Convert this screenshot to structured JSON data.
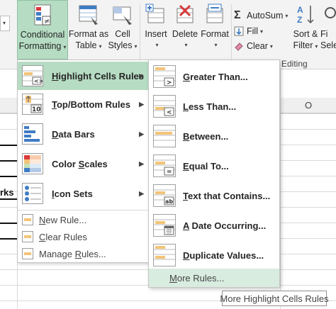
{
  "ribbon": {
    "conditional_formatting_line1": "Conditional",
    "conditional_formatting_line2": "Formatting",
    "format_as_table_line1": "Format as",
    "format_as_table_line2": "Table",
    "cell_styles_line1": "Cell",
    "cell_styles_line2": "Styles",
    "insert": "Insert",
    "delete": "Delete",
    "format": "Format",
    "autosum": "AutoSum",
    "fill": "Fill",
    "clear": "Clear",
    "sort_filter_line1": "Sort &",
    "sort_filter_line2": "Filter",
    "find_select_line1": "Fi",
    "find_select_line2": "Sele",
    "editing_label": "Editing"
  },
  "sheet": {
    "column_header_o": "O",
    "left_cell_text": "rks"
  },
  "conditional_menu": {
    "items": [
      {
        "label": "Highlight Cells Rules",
        "underline": "H",
        "rest": "ighlight Cells Rules"
      },
      {
        "label": "Top/Bottom Rules",
        "underline": "T",
        "rest": "op/Bottom Rules"
      },
      {
        "label": "Data Bars",
        "underline": "D",
        "rest": "ata Bars"
      },
      {
        "label": "Color Scales",
        "underline": "S",
        "pre": "Color ",
        "rest": "cales"
      },
      {
        "label": "Icon Sets",
        "underline": "I",
        "rest": "con Sets"
      }
    ],
    "small_items": [
      {
        "pre": "",
        "underline": "N",
        "rest": "ew Rule..."
      },
      {
        "pre": "",
        "underline": "C",
        "rest": "lear Rules"
      },
      {
        "pre": "Manage ",
        "underline": "R",
        "rest": "ules..."
      }
    ]
  },
  "highlight_menu": {
    "items": [
      {
        "underline": "G",
        "rest": "reater Than..."
      },
      {
        "underline": "L",
        "rest": "ess Than..."
      },
      {
        "underline": "B",
        "rest": "etween..."
      },
      {
        "underline": "E",
        "rest": "qual To..."
      },
      {
        "underline": "T",
        "rest": "ext that Contains..."
      },
      {
        "underline": "A",
        "rest": " Date Occurring..."
      },
      {
        "underline": "D",
        "rest": "uplicate Values..."
      }
    ],
    "more_rules": {
      "underline": "M",
      "rest": "ore Rules..."
    }
  },
  "tooltip": "More Highlight Cells Rules",
  "colors": {
    "active_item": "#b6dcc3",
    "more_rules_hover": "#d8ecdf",
    "icon_orange": "#f3c478",
    "icon_blue": "#3f7dc4",
    "icon_red": "#d9393b"
  }
}
